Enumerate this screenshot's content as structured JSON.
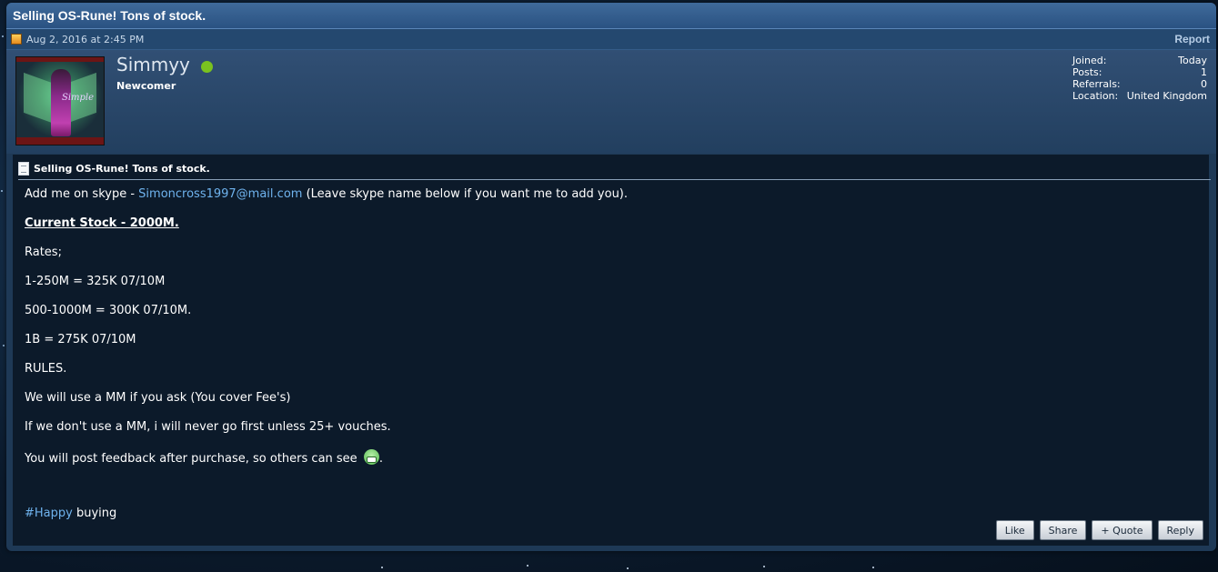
{
  "thread": {
    "title": "Selling OS-Rune! Tons of stock."
  },
  "post_meta": {
    "date": "Aug 2, 2016 at 2:45 PM",
    "report_label": "Report"
  },
  "author": {
    "username": "Simmyy",
    "user_title": "Newcomer",
    "avatar_text": "Simple",
    "online_color": "#7ac21f",
    "stats": [
      {
        "label": "Joined:",
        "value": "Today"
      },
      {
        "label": "Posts:",
        "value": "1"
      },
      {
        "label": "Referrals:",
        "value": "0"
      },
      {
        "label": "Location:",
        "value": "United Kingdom"
      }
    ]
  },
  "post": {
    "title": "Selling OS-Rune! Tons of stock.",
    "line1_prefix": "Add me on skype - ",
    "skype_link": "Simoncross1997@mail.com",
    "line1_suffix": " (Leave skype name below if you want me to add you).",
    "stock": "Current Stock - 2000M.",
    "rates_heading": "Rates;",
    "rate1": "1-250M = 325K 07/10M",
    "rate2": "500-1000M = 300K 07/10M.",
    "rate3": "1B = 275K 07/10M",
    "rules_heading": "RULES.",
    "rule1": "We will use a MM if you ask (You cover Fee's)",
    "rule2": "If we don't use a MM, i will never go first unless 25+ vouches.",
    "rule3_prefix": "You will post feedback after purchase, so others can see ",
    "rule3_suffix": ".",
    "hashtag": "#Happy",
    "hashtag_suffix": " buying"
  },
  "actions": {
    "like": "Like",
    "share": "Share",
    "quote": "+ Quote",
    "reply": "Reply"
  },
  "colors": {
    "link": "#6fb3ee",
    "title_bar": "#2a5282",
    "content_bg": "#0c1a2a"
  },
  "icons": [
    "post-date-icon",
    "online-status-icon",
    "document-icon",
    "grin-emoji-icon"
  ]
}
